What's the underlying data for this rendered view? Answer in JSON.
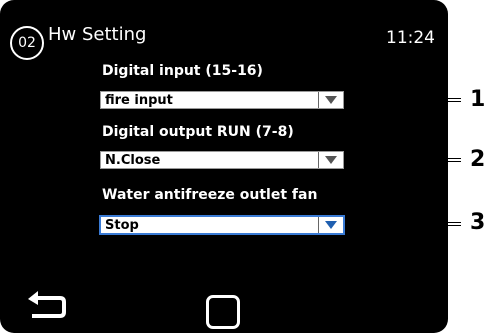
{
  "header": {
    "screen_number": "02",
    "title": "Hw Setting",
    "time": "11:24"
  },
  "settings": [
    {
      "label": "Digital input (15-16)",
      "value": "fire input",
      "callout": "1"
    },
    {
      "label": "Digital output RUN (7-8)",
      "value": "N.Close",
      "callout": "2"
    },
    {
      "label": "Water antifreeze outlet fan",
      "value": "Stop",
      "callout": "3"
    }
  ],
  "colors": {
    "screen_bg": "#000000",
    "text": "#ffffff",
    "focus": "#3a7bd5"
  },
  "icons": {
    "back": "back-arrow-icon",
    "home": "square-home-icon",
    "dropdown": "triangle-down-icon"
  }
}
